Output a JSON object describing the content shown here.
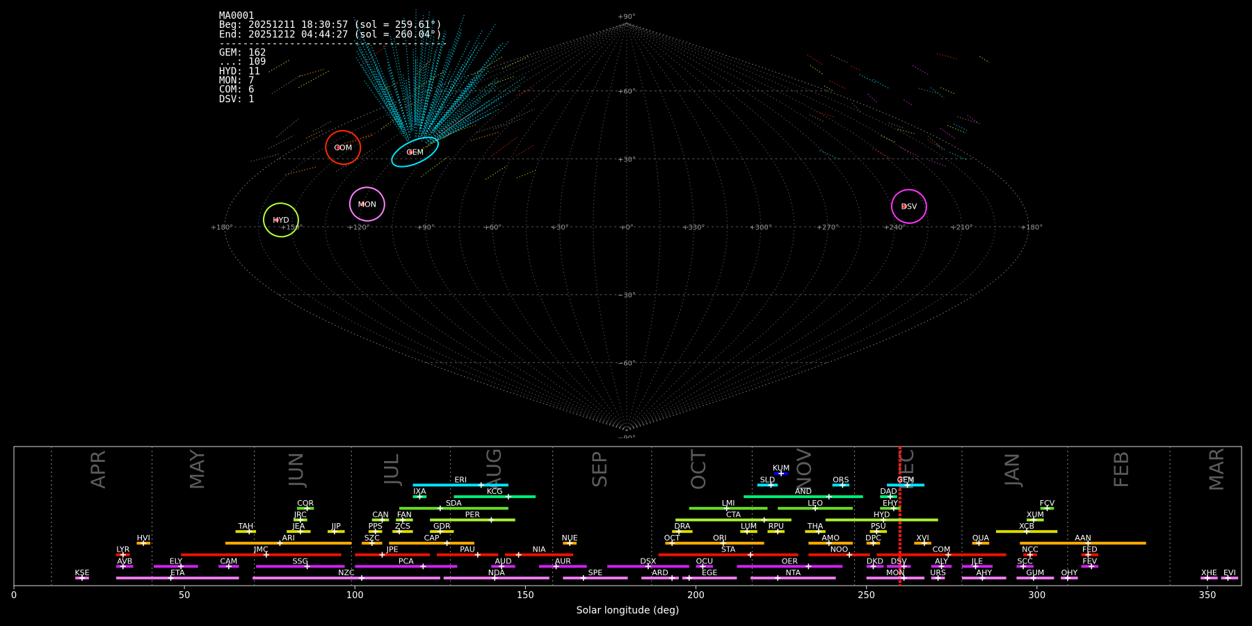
{
  "stats": {
    "lines": [
      "MA0001",
      "Beg: 20251211 18:30:57 (sol = 259.61°)",
      "End: 20251212 04:44:27 (sol = 260.04°)",
      "---------------------------------------",
      "GEM: 162",
      "...: 109",
      "HYD: 11",
      "MON: 7",
      "COM: 6",
      "DSV: 1"
    ]
  },
  "chart_data": [
    {
      "type": "scatter",
      "projection": "sinusoidal",
      "grid": true,
      "lon_tick_labels": [
        "+180°",
        "+150°",
        "+120°",
        "+90°",
        "+60°",
        "+30°",
        "+0°",
        "+330°",
        "+300°",
        "+270°",
        "+240°",
        "+210°",
        "+180°"
      ],
      "lat_tick_labels": [
        "+90°",
        "+60°",
        "+30°",
        "−30°",
        "−60°",
        "−90°"
      ],
      "lat_tick_values": [
        90,
        60,
        30,
        -30,
        -60,
        -90
      ],
      "radiants": [
        {
          "name": "GEM",
          "lon": 113,
          "lat": 33,
          "color": "#00e5ff"
        },
        {
          "name": "COM",
          "lon": 155,
          "lat": 35,
          "color": "#ff2a00"
        },
        {
          "name": "HYD",
          "lon": 155,
          "lat": 3,
          "color": "#b6ff3a"
        },
        {
          "name": "MON",
          "lon": 118,
          "lat": 10,
          "color": "#ff80ff"
        },
        {
          "name": "DSV",
          "lon": 232,
          "lat": 9,
          "color": "#ff33ff"
        }
      ]
    },
    {
      "type": "bar",
      "xlabel": "Solar longitude (deg)",
      "xlim": [
        0,
        360
      ],
      "x_ticks": [
        0,
        50,
        100,
        150,
        200,
        250,
        300,
        350
      ],
      "current_sol": [
        259.61,
        260.04
      ],
      "month_boundaries": [
        11,
        40.5,
        70.5,
        99,
        128,
        158,
        187,
        216.5,
        246.5,
        278,
        309,
        339
      ],
      "months": [
        {
          "label": "APR",
          "x": 25
        },
        {
          "label": "MAY",
          "x": 54
        },
        {
          "label": "JUN",
          "x": 83
        },
        {
          "label": "JUL",
          "x": 111
        },
        {
          "label": "AUG",
          "x": 141
        },
        {
          "label": "SEP",
          "x": 172
        },
        {
          "label": "OCT",
          "x": 201
        },
        {
          "label": "NOV",
          "x": 232
        },
        {
          "label": "DEC",
          "x": 262
        },
        {
          "label": "JAN",
          "x": 293
        },
        {
          "label": "FEB",
          "x": 325
        },
        {
          "label": "MAR",
          "x": 353
        }
      ],
      "showers": [
        {
          "code": "KUM",
          "start": 223,
          "end": 227,
          "peak": 225,
          "row": 9,
          "color": "#0000ee"
        },
        {
          "code": "ERI",
          "start": 117,
          "end": 145,
          "peak": 137,
          "row": 8,
          "color": "#00e5ff"
        },
        {
          "code": "SLD",
          "start": 218,
          "end": 224,
          "peak": 222,
          "row": 8,
          "color": "#00e5ff"
        },
        {
          "code": "ORS",
          "start": 240,
          "end": 245,
          "peak": 243,
          "row": 8,
          "color": "#00e5ff"
        },
        {
          "code": "GEM",
          "start": 256,
          "end": 267,
          "peak": 262,
          "row": 8,
          "color": "#00e5ff"
        },
        {
          "code": "IXA",
          "start": 117,
          "end": 121,
          "peak": 119,
          "row": 7,
          "color": "#00ee77"
        },
        {
          "code": "KCG",
          "start": 129,
          "end": 153,
          "peak": 145,
          "row": 7,
          "color": "#00ee77"
        },
        {
          "code": "AND",
          "start": 214,
          "end": 249,
          "peak": 239,
          "row": 7,
          "color": "#00ee77"
        },
        {
          "code": "DAD",
          "start": 254,
          "end": 259,
          "peak": 257,
          "row": 7,
          "color": "#00ee77"
        },
        {
          "code": "COR",
          "start": 83,
          "end": 88,
          "peak": 86,
          "row": 6,
          "color": "#66dd22"
        },
        {
          "code": "SDA",
          "start": 113,
          "end": 145,
          "peak": 125,
          "row": 6,
          "color": "#66dd22"
        },
        {
          "code": "LMI",
          "start": 198,
          "end": 221,
          "peak": 209,
          "row": 6,
          "color": "#66dd22"
        },
        {
          "code": "LEO",
          "start": 224,
          "end": 246,
          "peak": 235,
          "row": 6,
          "color": "#66dd22"
        },
        {
          "code": "EHY",
          "start": 254,
          "end": 260,
          "peak": 258,
          "row": 6,
          "color": "#66dd22"
        },
        {
          "code": "FCV",
          "start": 301,
          "end": 305,
          "peak": 303,
          "row": 6,
          "color": "#66dd22"
        },
        {
          "code": "JRC",
          "start": 82,
          "end": 86,
          "peak": 84,
          "row": 5,
          "color": "#aaee33"
        },
        {
          "code": "CAN",
          "start": 105,
          "end": 110,
          "peak": 108,
          "row": 5,
          "color": "#aaee33"
        },
        {
          "code": "FAN",
          "start": 112,
          "end": 117,
          "peak": 114,
          "row": 5,
          "color": "#aaee33"
        },
        {
          "code": "PER",
          "start": 122,
          "end": 147,
          "peak": 140,
          "row": 5,
          "color": "#aaee33"
        },
        {
          "code": "CTA",
          "start": 194,
          "end": 228,
          "peak": 220,
          "row": 5,
          "color": "#aaee33"
        },
        {
          "code": "HYD",
          "start": 238,
          "end": 271,
          "peak": 255,
          "row": 5,
          "color": "#aaee33"
        },
        {
          "code": "XUM",
          "start": 297,
          "end": 302,
          "peak": 299,
          "row": 5,
          "color": "#aaee33"
        },
        {
          "code": "TAH",
          "start": 65,
          "end": 71,
          "peak": 69,
          "row": 4,
          "color": "#dddd00"
        },
        {
          "code": "JEA",
          "start": 80,
          "end": 87,
          "peak": 84,
          "row": 4,
          "color": "#dddd00"
        },
        {
          "code": "JIP",
          "start": 92,
          "end": 97,
          "peak": 94,
          "row": 4,
          "color": "#dddd00"
        },
        {
          "code": "PPS",
          "start": 104,
          "end": 108,
          "peak": 106,
          "row": 4,
          "color": "#dddd00"
        },
        {
          "code": "ZCS",
          "start": 111,
          "end": 117,
          "peak": 113,
          "row": 4,
          "color": "#dddd00"
        },
        {
          "code": "GDR",
          "start": 122,
          "end": 129,
          "peak": 125,
          "row": 4,
          "color": "#dddd00"
        },
        {
          "code": "DRA",
          "start": 193,
          "end": 199,
          "peak": 195,
          "row": 4,
          "color": "#dddd00"
        },
        {
          "code": "LUM",
          "start": 213,
          "end": 218,
          "peak": 215,
          "row": 4,
          "color": "#dddd00"
        },
        {
          "code": "RPU",
          "start": 221,
          "end": 226,
          "peak": 224,
          "row": 4,
          "color": "#dddd00"
        },
        {
          "code": "THA",
          "start": 232,
          "end": 238,
          "peak": 236,
          "row": 4,
          "color": "#dddd00"
        },
        {
          "code": "PSU",
          "start": 251,
          "end": 256,
          "peak": 253,
          "row": 4,
          "color": "#dddd00"
        },
        {
          "code": "XCB",
          "start": 288,
          "end": 306,
          "peak": 297,
          "row": 4,
          "color": "#dddd00"
        },
        {
          "code": "HVI",
          "start": 36,
          "end": 40,
          "peak": 38,
          "row": 3,
          "color": "#ffaa00"
        },
        {
          "code": "ARI",
          "start": 62,
          "end": 99,
          "peak": 78,
          "row": 3,
          "color": "#ffaa00"
        },
        {
          "code": "SZC",
          "start": 102,
          "end": 108,
          "peak": 105,
          "row": 3,
          "color": "#ffaa00"
        },
        {
          "code": "CAP",
          "start": 110,
          "end": 135,
          "peak": 127,
          "row": 3,
          "color": "#ffaa00"
        },
        {
          "code": "NUE",
          "start": 161,
          "end": 165,
          "peak": 163,
          "row": 3,
          "color": "#ffaa00"
        },
        {
          "code": "OCT",
          "start": 191,
          "end": 195,
          "peak": 193,
          "row": 3,
          "color": "#ffaa00"
        },
        {
          "code": "ORI",
          "start": 194,
          "end": 220,
          "peak": 208,
          "row": 3,
          "color": "#ffaa00"
        },
        {
          "code": "AMO",
          "start": 233,
          "end": 246,
          "peak": 239,
          "row": 3,
          "color": "#ffaa00"
        },
        {
          "code": "DPC",
          "start": 250,
          "end": 254,
          "peak": 252,
          "row": 3,
          "color": "#ffaa00"
        },
        {
          "code": "XVI",
          "start": 264,
          "end": 269,
          "peak": 267,
          "row": 3,
          "color": "#ffaa00"
        },
        {
          "code": "QUA",
          "start": 281,
          "end": 286,
          "peak": 283,
          "row": 3,
          "color": "#ffaa00"
        },
        {
          "code": "AAN",
          "start": 295,
          "end": 332,
          "peak": 315,
          "row": 3,
          "color": "#ffaa00"
        },
        {
          "code": "LYR",
          "start": 30,
          "end": 34,
          "peak": 32,
          "row": 2,
          "color": "#ee1100"
        },
        {
          "code": "JMC",
          "start": 49,
          "end": 96,
          "peak": 74,
          "row": 2,
          "color": "#ee1100"
        },
        {
          "code": "JPE",
          "start": 100,
          "end": 122,
          "peak": 108,
          "row": 2,
          "color": "#ee1100"
        },
        {
          "code": "PAU",
          "start": 124,
          "end": 142,
          "peak": 136,
          "row": 2,
          "color": "#ee1100"
        },
        {
          "code": "NIA",
          "start": 144,
          "end": 164,
          "peak": 148,
          "row": 2,
          "color": "#ee1100"
        },
        {
          "code": "STA",
          "start": 189,
          "end": 230,
          "peak": 216,
          "row": 2,
          "color": "#ee1100"
        },
        {
          "code": "NOO",
          "start": 233,
          "end": 251,
          "peak": 245,
          "row": 2,
          "color": "#ee1100"
        },
        {
          "code": "COM",
          "start": 253,
          "end": 291,
          "peak": 274,
          "row": 2,
          "color": "#ee1100"
        },
        {
          "code": "NCC",
          "start": 296,
          "end": 300,
          "peak": 298,
          "row": 2,
          "color": "#ee1100"
        },
        {
          "code": "FED",
          "start": 313,
          "end": 318,
          "peak": 315,
          "row": 2,
          "color": "#ee1100"
        },
        {
          "code": "AVB",
          "start": 30,
          "end": 35,
          "peak": 32,
          "row": 1,
          "color": "#cc22ee"
        },
        {
          "code": "ELY",
          "start": 41,
          "end": 54,
          "peak": 49,
          "row": 1,
          "color": "#cc22ee"
        },
        {
          "code": "CAM",
          "start": 60,
          "end": 66,
          "peak": 63,
          "row": 1,
          "color": "#cc22ee"
        },
        {
          "code": "SSG",
          "start": 71,
          "end": 97,
          "peak": 86,
          "row": 1,
          "color": "#cc22ee"
        },
        {
          "code": "PCA",
          "start": 100,
          "end": 130,
          "peak": 120,
          "row": 1,
          "color": "#cc22ee"
        },
        {
          "code": "AUD",
          "start": 140,
          "end": 147,
          "peak": 143,
          "row": 1,
          "color": "#cc22ee"
        },
        {
          "code": "AUR",
          "start": 154,
          "end": 168,
          "peak": 159,
          "row": 1,
          "color": "#cc22ee"
        },
        {
          "code": "DSX",
          "start": 174,
          "end": 198,
          "peak": 186,
          "row": 1,
          "color": "#cc22ee"
        },
        {
          "code": "OCU",
          "start": 200,
          "end": 205,
          "peak": 202,
          "row": 1,
          "color": "#cc22ee"
        },
        {
          "code": "OER",
          "start": 212,
          "end": 243,
          "peak": 233,
          "row": 1,
          "color": "#cc22ee"
        },
        {
          "code": "DKD",
          "start": 250,
          "end": 255,
          "peak": 252,
          "row": 1,
          "color": "#cc22ee"
        },
        {
          "code": "DSV",
          "start": 256,
          "end": 263,
          "peak": 261,
          "row": 1,
          "color": "#cc22ee"
        },
        {
          "code": "ALY",
          "start": 269,
          "end": 275,
          "peak": 272,
          "row": 1,
          "color": "#cc22ee"
        },
        {
          "code": "JLE",
          "start": 278,
          "end": 287,
          "peak": 282,
          "row": 1,
          "color": "#cc22ee"
        },
        {
          "code": "SCC",
          "start": 294,
          "end": 299,
          "peak": 296,
          "row": 1,
          "color": "#cc22ee"
        },
        {
          "code": "FEV",
          "start": 313,
          "end": 318,
          "peak": 316,
          "row": 1,
          "color": "#cc22ee"
        },
        {
          "code": "KSE",
          "start": 18,
          "end": 22,
          "peak": 20,
          "row": 0,
          "color": "#ee77ee"
        },
        {
          "code": "ETA",
          "start": 30,
          "end": 66,
          "peak": 46,
          "row": 0,
          "color": "#ee77ee"
        },
        {
          "code": "NZC",
          "start": 70,
          "end": 125,
          "peak": 102,
          "row": 0,
          "color": "#ee77ee"
        },
        {
          "code": "NDA",
          "start": 126,
          "end": 157,
          "peak": 141,
          "row": 0,
          "color": "#ee77ee"
        },
        {
          "code": "SPE",
          "start": 161,
          "end": 180,
          "peak": 167,
          "row": 0,
          "color": "#ee77ee"
        },
        {
          "code": "ARD",
          "start": 184,
          "end": 195,
          "peak": 193,
          "row": 0,
          "color": "#ee77ee"
        },
        {
          "code": "EGE",
          "start": 196,
          "end": 212,
          "peak": 198,
          "row": 0,
          "color": "#ee77ee"
        },
        {
          "code": "NTA",
          "start": 216,
          "end": 241,
          "peak": 224,
          "row": 0,
          "color": "#ee77ee"
        },
        {
          "code": "MON",
          "start": 250,
          "end": 267,
          "peak": 261,
          "row": 0,
          "color": "#ee77ee"
        },
        {
          "code": "URS",
          "start": 269,
          "end": 273,
          "peak": 271,
          "row": 0,
          "color": "#ee77ee"
        },
        {
          "code": "AHY",
          "start": 278,
          "end": 291,
          "peak": 284,
          "row": 0,
          "color": "#ee77ee"
        },
        {
          "code": "GUM",
          "start": 294,
          "end": 305,
          "peak": 299,
          "row": 0,
          "color": "#ee77ee"
        },
        {
          "code": "OHY",
          "start": 307,
          "end": 312,
          "peak": 309,
          "row": 0,
          "color": "#ee77ee"
        },
        {
          "code": "XHE",
          "start": 348,
          "end": 353,
          "peak": 350,
          "row": 0,
          "color": "#ee77ee"
        },
        {
          "code": "EVI",
          "start": 354,
          "end": 359,
          "peak": 356,
          "row": 0,
          "color": "#ee77ee"
        }
      ]
    }
  ]
}
